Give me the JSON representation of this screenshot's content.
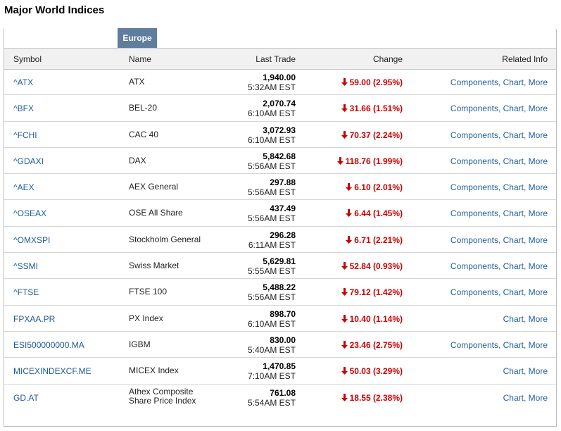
{
  "page_title": "Major World Indices",
  "tab_label": "Europe",
  "columns": {
    "symbol": "Symbol",
    "name": "Name",
    "last_trade": "Last Trade",
    "change": "Change",
    "related": "Related Info"
  },
  "links": {
    "components": "Components",
    "chart": "Chart",
    "more": "More",
    "sep": ", "
  },
  "rows": [
    {
      "symbol": "^ATX",
      "name": "ATX",
      "price": "1,940.00",
      "time": "5:32AM EST",
      "change": "59.00 (2.95%)",
      "components": true
    },
    {
      "symbol": "^BFX",
      "name": "BEL-20",
      "price": "2,070.74",
      "time": "6:10AM EST",
      "change": "31.66 (1.51%)",
      "components": true
    },
    {
      "symbol": "^FCHI",
      "name": "CAC 40",
      "price": "3,072.93",
      "time": "6:10AM EST",
      "change": "70.37 (2.24%)",
      "components": true
    },
    {
      "symbol": "^GDAXI",
      "name": "DAX",
      "price": "5,842.68",
      "time": "5:56AM EST",
      "change": "118.76 (1.99%)",
      "components": true
    },
    {
      "symbol": "^AEX",
      "name": "AEX General",
      "price": "297.88",
      "time": "5:56AM EST",
      "change": "6.10 (2.01%)",
      "components": true
    },
    {
      "symbol": "^OSEAX",
      "name": "OSE All Share",
      "price": "437.49",
      "time": "5:56AM EST",
      "change": "6.44 (1.45%)",
      "components": true
    },
    {
      "symbol": "^OMXSPI",
      "name": "Stockholm General",
      "price": "296.28",
      "time": "6:11AM EST",
      "change": "6.71 (2.21%)",
      "components": true
    },
    {
      "symbol": "^SSMI",
      "name": "Swiss Market",
      "price": "5,629.81",
      "time": "5:55AM EST",
      "change": "52.84 (0.93%)",
      "components": true
    },
    {
      "symbol": "^FTSE",
      "name": "FTSE 100",
      "price": "5,488.22",
      "time": "5:56AM EST",
      "change": "79.12 (1.42%)",
      "components": true
    },
    {
      "symbol": "FPXAA.PR",
      "name": "PX Index",
      "price": "898.70",
      "time": "6:10AM EST",
      "change": "10.40 (1.14%)",
      "components": false
    },
    {
      "symbol": "ESI500000000.MA",
      "name": "IGBM",
      "price": "830.00",
      "time": "5:40AM EST",
      "change": "23.46 (2.75%)",
      "components": true
    },
    {
      "symbol": "MICEXINDEXCF.ME",
      "name": "MICEX Index",
      "price": "1,470.85",
      "time": "7:10AM EST",
      "change": "50.03 (3.29%)",
      "components": false
    },
    {
      "symbol": "GD.AT",
      "name": "Athex Composite Share Price Index",
      "name_line1": "Athex Composite",
      "name_line2": "Share Price Index",
      "price": "761.08",
      "time": "5:54AM EST",
      "change": "18.55 (2.38%)",
      "components": false
    }
  ],
  "colors": {
    "tab_bg": "#5f7d9c",
    "link": "#1f5c99",
    "down": "#cc0000",
    "header_bg": "#f1f1f1"
  },
  "icons": {
    "down_arrow": "down-arrow-icon"
  }
}
